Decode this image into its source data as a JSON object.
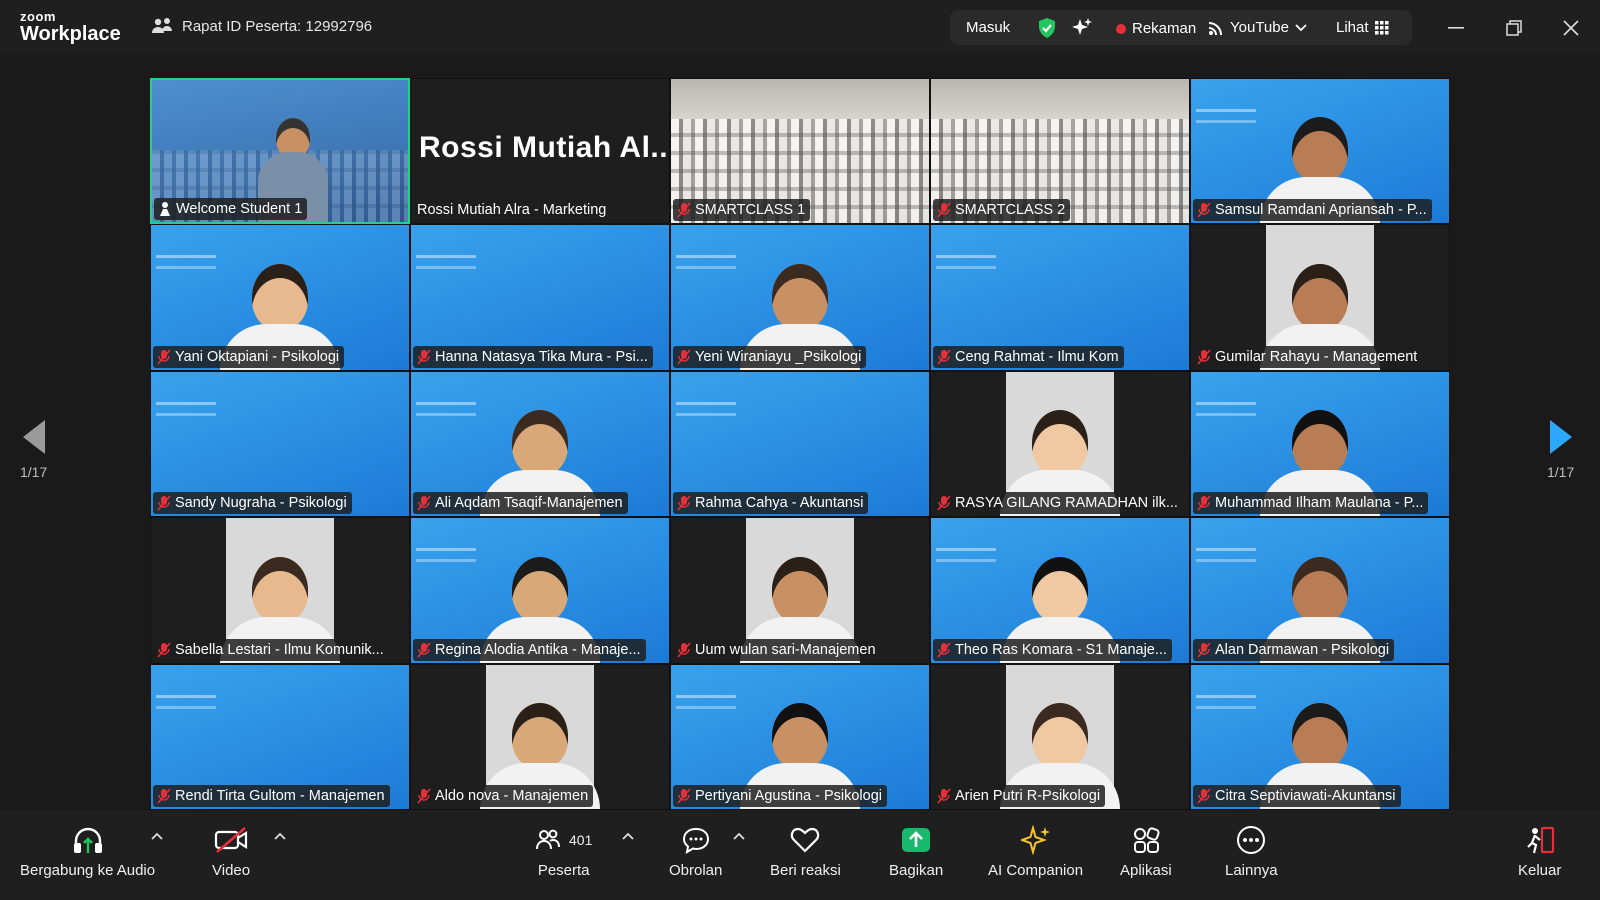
{
  "app": {
    "logo_top": "zoom",
    "logo_bottom": "Workplace"
  },
  "header": {
    "meeting_id": "Rapat ID Peserta: 12992796",
    "sign_in": "Masuk",
    "recording": "Rekaman",
    "stream": "YouTube",
    "view": "Lihat"
  },
  "gallery": {
    "tiles": [
      {
        "name": "Welcome Student 1",
        "bg": "stage",
        "mic": "on",
        "active": true
      },
      {
        "name": "Rossi Mutiah Alra - Marketing",
        "bg": "dark",
        "big": "Rossi Mutiah Al...",
        "mic": "none"
      },
      {
        "name": "SMARTCLASS 1",
        "bg": "class",
        "mic": "off"
      },
      {
        "name": "SMARTCLASS 2",
        "bg": "class",
        "mic": "off"
      },
      {
        "name": "Samsul Ramdani Apriansah - P...",
        "bg": "blue",
        "person": true,
        "mic": "off"
      },
      {
        "name": "Yani Oktapiani - Psikologi",
        "bg": "blue",
        "person": true,
        "mic": "off"
      },
      {
        "name": "Hanna Natasya Tika Mura - Psi...",
        "bg": "blue",
        "mic": "off"
      },
      {
        "name": "Yeni Wiraniayu _Psikologi",
        "bg": "blue",
        "person": true,
        "mic": "off"
      },
      {
        "name": "Ceng Rahmat - Ilmu Kom",
        "bg": "blue",
        "mic": "off"
      },
      {
        "name": "Gumilar Rahayu - Management",
        "bg": "cam",
        "person": true,
        "mic": "off"
      },
      {
        "name": "Sandy Nugraha - Psikologi",
        "bg": "blue",
        "mic": "off"
      },
      {
        "name": "Ali Aqdam Tsaqif-Manajemen",
        "bg": "blue",
        "person": true,
        "mic": "off"
      },
      {
        "name": "Rahma Cahya - Akuntansi",
        "bg": "blue",
        "mic": "off"
      },
      {
        "name": "RASYA GILANG RAMADHAN ilk...",
        "bg": "cam",
        "person": true,
        "mic": "off"
      },
      {
        "name": "Muhammad Ilham Maulana - P...",
        "bg": "blue",
        "person": true,
        "mic": "off"
      },
      {
        "name": "Sabella Lestari - Ilmu Komunik...",
        "bg": "cam",
        "person": true,
        "mic": "off"
      },
      {
        "name": "Regina Alodia Antika - Manaje...",
        "bg": "blue",
        "person": true,
        "mic": "off"
      },
      {
        "name": "Uum wulan sari-Manajemen",
        "bg": "cam",
        "person": true,
        "mic": "off"
      },
      {
        "name": "Theo Ras Komara - S1 Manaje...",
        "bg": "blue",
        "person": true,
        "mic": "off"
      },
      {
        "name": "Alan Darmawan - Psikologi",
        "bg": "blue",
        "person": true,
        "mic": "off"
      },
      {
        "name": "Rendi Tirta Gultom - Manajemen",
        "bg": "blue",
        "mic": "off"
      },
      {
        "name": "Aldo nova - Manajemen",
        "bg": "cam",
        "person": true,
        "mic": "off"
      },
      {
        "name": "Pertiyani Agustina -  Psikologi",
        "bg": "blue",
        "person": true,
        "mic": "off"
      },
      {
        "name": "Arien Putri R-Psikologi",
        "bg": "cam",
        "person": true,
        "mic": "off"
      },
      {
        "name": "Citra Septiviawati-Akuntansi",
        "bg": "blue",
        "person": true,
        "mic": "off"
      }
    ],
    "page_left": "1/17",
    "page_right": "1/17"
  },
  "toolbar": {
    "audio": "Bergabung ke Audio",
    "video": "Video",
    "participants": "Peserta",
    "participants_count": "401",
    "chat": "Obrolan",
    "react": "Beri reaksi",
    "share": "Bagikan",
    "ai": "AI Companion",
    "apps": "Aplikasi",
    "more": "Lainnya",
    "leave": "Keluar"
  },
  "colors": {
    "accent_green": "#1fd38a",
    "share_green": "#19b96d",
    "mic_red": "#e5303a",
    "ai_yellow": "#f4c430"
  }
}
